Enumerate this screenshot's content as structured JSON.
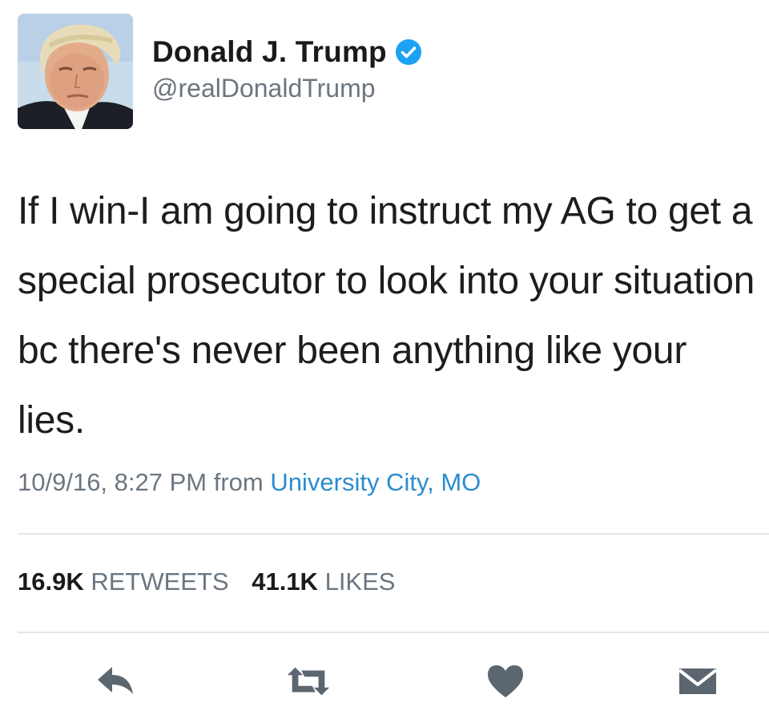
{
  "tweet": {
    "author": {
      "display_name": "Donald J. Trump",
      "handle": "@realDonaldTrump",
      "verified": true,
      "avatar_icon": "profile-photo"
    },
    "text": "If I win-I am going to instruct my AG to get a special prosecutor to look into your situation bc there's never been anything like your lies.",
    "meta": {
      "datetime": "10/9/16, 8:27 PM",
      "from_label": "from",
      "location": "University City, MO"
    },
    "stats": {
      "retweets_count": "16.9K",
      "retweets_label": "RETWEETS",
      "likes_count": "41.1K",
      "likes_label": "LIKES"
    },
    "actions": [
      {
        "name": "reply",
        "icon": "reply-icon"
      },
      {
        "name": "retweet",
        "icon": "retweet-icon"
      },
      {
        "name": "like",
        "icon": "heart-icon"
      },
      {
        "name": "direct-message",
        "icon": "envelope-icon"
      }
    ]
  },
  "colors": {
    "text": "#1a1a1a",
    "secondary": "#6b7680",
    "link": "#2b8ccf",
    "verified": "#1da1f2",
    "icon": "#5c6670",
    "divider": "#e3e6e8"
  }
}
